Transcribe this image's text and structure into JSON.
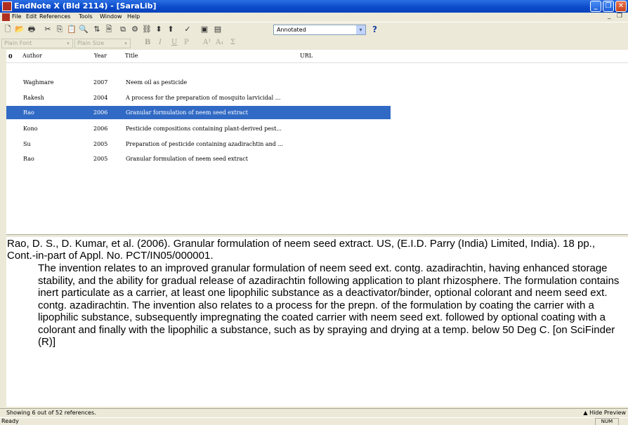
{
  "titlebar": {
    "title": "EndNote X (Bld 2114) - [SaraLib]",
    "minimize": "_",
    "restore": "❐",
    "close": "✕"
  },
  "menubar": {
    "items": [
      "File",
      "Edit",
      "References",
      "Tools",
      "Window",
      "Help"
    ],
    "mdi_min": "_",
    "mdi_restore": "❐"
  },
  "toolbar": {
    "output_style": "Annotated",
    "dropdown_glyph": "▾",
    "help": "?"
  },
  "format_toolbar": {
    "font": "Plain Font",
    "size": "Plain Size",
    "bold": "B",
    "italic": "I",
    "underline": "U",
    "plain": "P",
    "superscript": "A¹",
    "subscript": "A₁",
    "symbol": "Σ"
  },
  "columns": {
    "attachment": "0",
    "author": "Author",
    "year": "Year",
    "title": "Title",
    "url": "URL"
  },
  "references": [
    {
      "author": "Waghmare",
      "year": "2007",
      "title": "Neem oil as pesticide"
    },
    {
      "author": "Rakesh",
      "year": "2004",
      "title": "A process for the preparation of mosquito larvicidal ..."
    },
    {
      "author": "Rao",
      "year": "2006",
      "title": "Granular formulation of neem seed extract"
    },
    {
      "author": "Kono",
      "year": "2006",
      "title": "Pesticide compositions containing plant-derived pest..."
    },
    {
      "author": "Su",
      "year": "2005",
      "title": "Preparation of pesticide containing azadirachtin and ..."
    },
    {
      "author": "Rao",
      "year": "2005",
      "title": "Granular formulation of neem seed extract"
    }
  ],
  "selected_index": 2,
  "preview": {
    "citation": "Rao, D. S., D. Kumar, et al. (2006). Granular formulation of neem seed extract. US, (E.I.D. Parry (India) Limited, India). 18 pp., Cont.-in-part of Appl. No. PCT/IN05/000001.",
    "abstract_first": "The invention relates to an improved granular formulation of neem seed ext. contg. azadirachtin, having enhanced",
    "abstract_rest": "storage stability, and the ability for gradual release of azadirachtin following application to plant rhizosphere. The formulation contains inert particulate as a carrier, at least one lipophilic substance as a deactivator/binder, optional colorant and neem seed ext. contg. azadirachtin. The invention also relates to a process for the prepn. of the formulation by coating the carrier with a lipophilic substance, subsequently impregnating the coated carrier with neem seed ext. followed by optional coating with a colorant and finally with the lipophilic a substance, such as by spraying and drying at a temp. below 50 Deg C. [on SciFinder (R)]"
  },
  "status": {
    "showing": "Showing 6 out of 52 references.",
    "hide_preview": "▲ Hide Preview",
    "ready": "Ready",
    "num": "NUM"
  },
  "colors": {
    "title_bar": "#0a49c9",
    "selection": "#316ac5",
    "chrome": "#ece9d8"
  }
}
